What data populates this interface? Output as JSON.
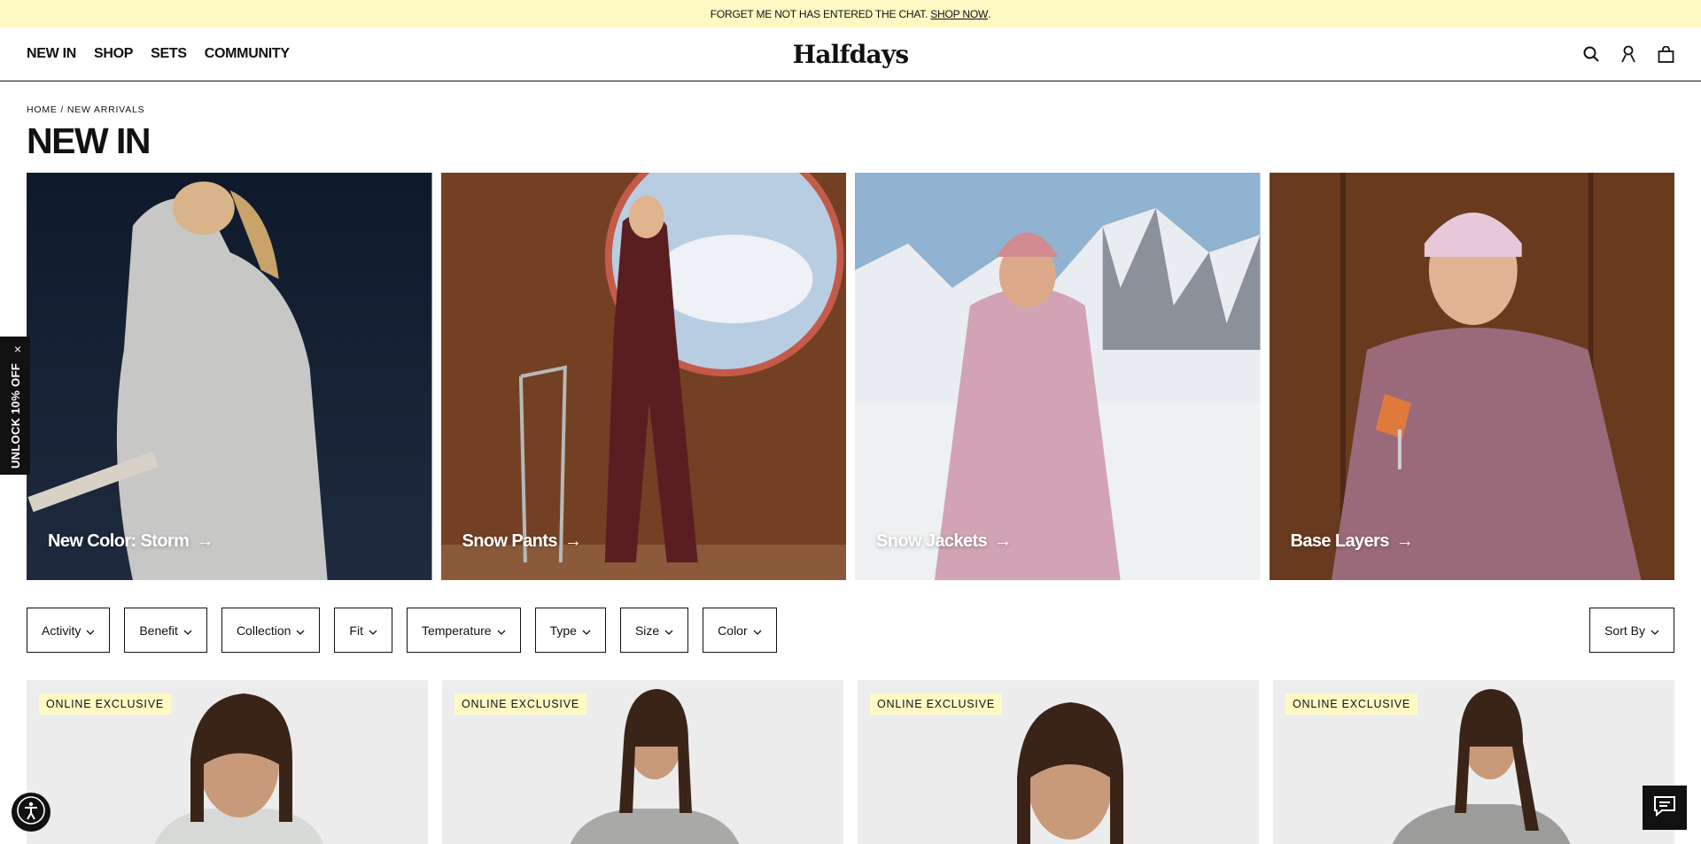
{
  "announcement": {
    "text": "FORGET ME NOT HAS ENTERED THE CHAT.",
    "link": "SHOP NOW",
    "after": "."
  },
  "header": {
    "nav": [
      "NEW IN",
      "SHOP",
      "SETS",
      "COMMUNITY"
    ],
    "logo": "Halfdays",
    "icons": [
      "search-icon",
      "account-icon",
      "bag-icon"
    ]
  },
  "breadcrumb": {
    "home": "HOME",
    "sep": " / ",
    "current": "NEW ARRIVALS"
  },
  "page_title": "NEW IN",
  "tiles": [
    {
      "label": "New Color: Storm"
    },
    {
      "label": "Snow Pants"
    },
    {
      "label": "Snow Jackets"
    },
    {
      "label": "Base Layers"
    }
  ],
  "filters": [
    "Activity",
    "Benefit",
    "Collection",
    "Fit",
    "Temperature",
    "Type",
    "Size",
    "Color"
  ],
  "sort_label": "Sort By",
  "products": [
    {
      "badge": "ONLINE EXCLUSIVE"
    },
    {
      "badge": "ONLINE EXCLUSIVE"
    },
    {
      "badge": "ONLINE EXCLUSIVE"
    },
    {
      "badge": "ONLINE EXCLUSIVE"
    }
  ],
  "promo_tab": {
    "text": "UNLOCK 10% OFF",
    "close": "×"
  },
  "colors": {
    "announcement_bg": "#fff9c4",
    "badge_bg": "#fff9c4",
    "text": "#111111"
  }
}
